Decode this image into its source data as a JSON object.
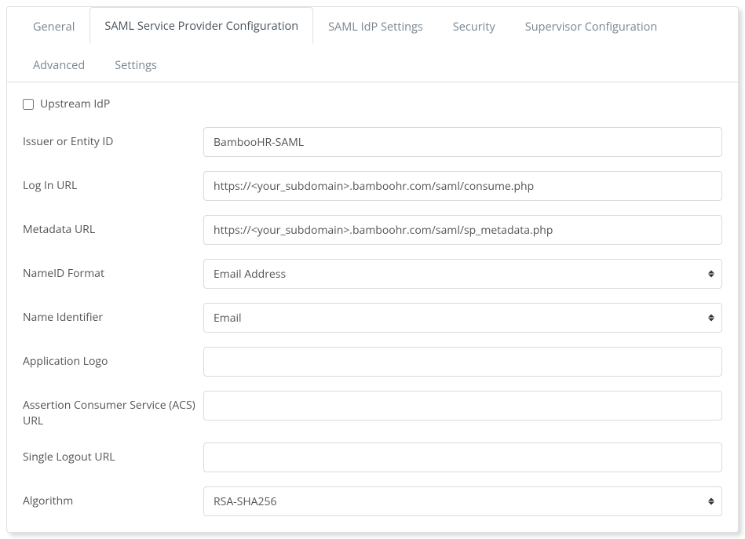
{
  "tabs": {
    "general": "General",
    "saml_sp": "SAML Service Provider Configuration",
    "saml_idp": "SAML IdP Settings",
    "security": "Security",
    "supervisor": "Supervisor Configuration",
    "advanced": "Advanced",
    "settings": "Settings"
  },
  "form": {
    "upstream_idp": {
      "label": "Upstream IdP",
      "checked": false
    },
    "issuer": {
      "label": "Issuer or Entity ID",
      "value": "BambooHR-SAML"
    },
    "login_url": {
      "label": "Log In URL",
      "value": "https://<your_subdomain>.bamboohr.com/saml/consume.php"
    },
    "metadata_url": {
      "label": "Metadata URL",
      "value": "https://<your_subdomain>.bamboohr.com/saml/sp_metadata.php"
    },
    "nameid_format": {
      "label": "NameID Format",
      "value": "Email Address"
    },
    "name_identifier": {
      "label": "Name Identifier",
      "value": "Email"
    },
    "app_logo": {
      "label": "Application Logo",
      "value": ""
    },
    "acs_url": {
      "label": "Assertion Consumer Service (ACS) URL",
      "value": ""
    },
    "slo_url": {
      "label": "Single Logout URL",
      "value": ""
    },
    "algorithm": {
      "label": "Algorithm",
      "value": "RSA-SHA256"
    }
  }
}
